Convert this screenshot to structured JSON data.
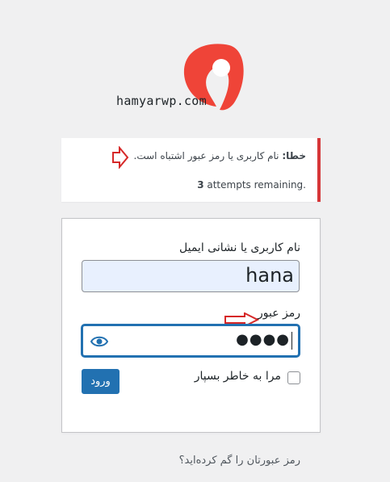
{
  "logo": {
    "text": "hamyarwp.com",
    "icon": "hamyar-logo-icon",
    "color": "#ef4438"
  },
  "notice": {
    "error_prefix": "خطا:",
    "error_message": " نام کاربری یا رمز عبور اشتباه است.",
    "attempts_count": "3",
    "attempts_text": " attempts remaining.",
    "border_color": "#d63638"
  },
  "form": {
    "username_label": "نام کاربری یا نشانی ایمیل",
    "username_value": "hana",
    "password_label": "رمز عبور",
    "password_value": "●●●●",
    "remember_label": "مرا به خاطر بسپار",
    "remember_checked": false,
    "submit_label": "ورود",
    "accent": "#2271b1"
  },
  "links": {
    "lost_password": "رمز عبورتان را گم کرده‌اید؟"
  },
  "annotations": {
    "arrow_icon": "red-outline-arrow-icon",
    "arrow_color": "#d62828"
  }
}
